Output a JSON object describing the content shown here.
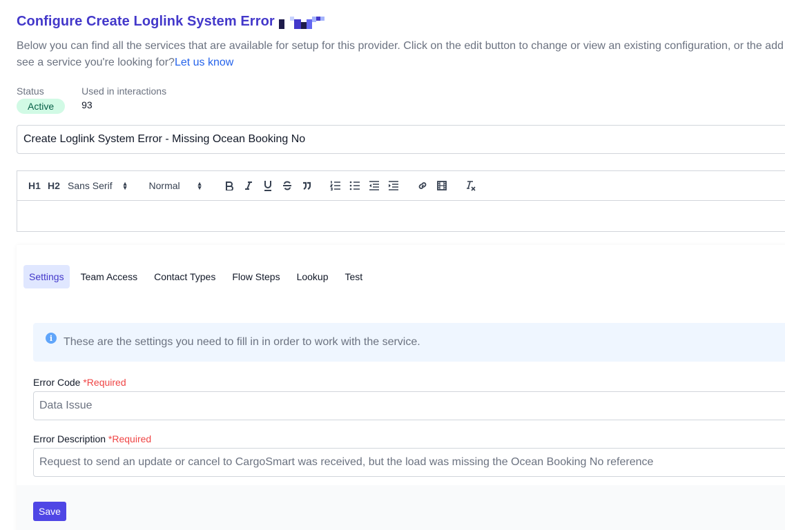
{
  "header": {
    "title": "Configure Create Loglink System Error",
    "description_line1": "Below you can find all the services that are available for setup for this provider. Click on the edit button to change or view an existing configuration, or the add",
    "description_line2": "see a service you're looking for?",
    "link_text": "Let us know",
    "brand_colors": [
      "#1e1b4b",
      "#4338ca",
      "#6366f1",
      "#a5b4fc",
      "#c7d2fe"
    ]
  },
  "meta": {
    "status_label": "Status",
    "status_value": "Active",
    "interactions_label": "Used in interactions",
    "interactions_value": "93"
  },
  "name_input": {
    "value": "Create Loglink System Error - Missing Ocean Booking No"
  },
  "editor": {
    "h1": "H1",
    "h2": "H2",
    "font_select": "Sans Serif",
    "size_select": "Normal",
    "icons": [
      "bold-icon",
      "italic-icon",
      "underline-icon",
      "strike-icon",
      "quote-icon",
      "ordered-list-icon",
      "bullet-list-icon",
      "outdent-icon",
      "indent-icon",
      "link-icon",
      "video-icon",
      "clear-format-icon"
    ]
  },
  "tabs": [
    "Settings",
    "Team Access",
    "Contact Types",
    "Flow Steps",
    "Lookup",
    "Test"
  ],
  "active_tab": "Settings",
  "info": {
    "text": "These are the settings you need to fill in in order to work with the service."
  },
  "fields": {
    "error_code_label": "Error Code",
    "error_code_required": "*Required",
    "error_code_placeholder": "Data Issue",
    "error_description_label": "Error Description",
    "error_description_required": "*Required",
    "error_description_placeholder": "Request to send an update or cancel to CargoSmart was received, but the load was missing the Ocean Booking No reference"
  },
  "save_label": "Save",
  "colors": {
    "accent": "#4f46e5",
    "title": "#4338ca",
    "status_bg": "#d1fae5",
    "required": "#ef4444",
    "info_bg": "#eff6ff"
  }
}
